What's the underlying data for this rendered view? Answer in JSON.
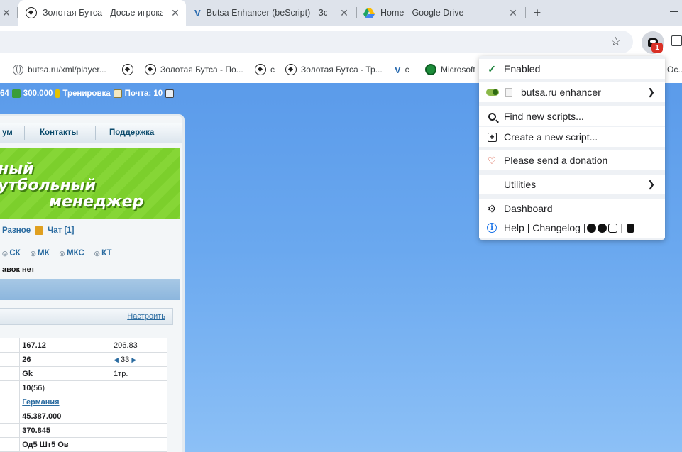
{
  "tabs": [
    {
      "title": "",
      "close": "✕"
    },
    {
      "title": "Золотая Бутса - Досье игрока",
      "close": "✕"
    },
    {
      "title": "Butsa Enhancer (beScript) - Зол",
      "close": "✕"
    },
    {
      "title": "Home - Google Drive",
      "close": "✕"
    }
  ],
  "new_tab": "+",
  "toolbar": {
    "star": "☆",
    "badge": "1"
  },
  "bookmarks": [
    "butsa.ru/xml/player...",
    "",
    "Золотая Бутса - По...",
    "",
    "с",
    "Золотая Бутса - Тр...",
    "с",
    "Microsoft",
    "Ос..."
  ],
  "site": {
    "topbar": {
      "num": "64",
      "money": "300.000",
      "training": "Тренировка",
      "mail": "Почта: 10"
    },
    "nav": [
      "ум",
      "Контакты",
      "Поддержка"
    ],
    "banner": [
      "ный",
      "утбольный",
      "менеджер"
    ],
    "row1": [
      "Разное",
      "Чат [1]"
    ],
    "row2": [
      "СК",
      "МК",
      "МКС",
      "КТ"
    ],
    "row3": "авок нет",
    "configure": "Настроить",
    "table": [
      [
        "167.12",
        "206.83"
      ],
      [
        "26",
        "33"
      ],
      [
        "Gk",
        "1тр."
      ],
      [
        "10",
        "(56)",
        ""
      ],
      [
        "Германия",
        ""
      ],
      [
        "45.387.000",
        ""
      ],
      [
        "370.845",
        ""
      ],
      [
        "Од5 Шт5 Ов",
        ""
      ]
    ]
  },
  "menu": {
    "enabled": "Enabled",
    "script": "butsa.ru enhancer",
    "find": "Find new scripts...",
    "create": "Create a new script...",
    "donate": "Please send a donation",
    "utilities": "Utilities",
    "dashboard": "Dashboard",
    "help": "Help",
    "sep": "|",
    "changelog": "Changelog"
  },
  "icons": {
    "check": "check-icon",
    "toggle": "toggle-icon",
    "search": "search-icon",
    "plus": "plus-box-icon",
    "heart": "heart-icon",
    "gear": "gear-icon",
    "info": "info-icon"
  }
}
